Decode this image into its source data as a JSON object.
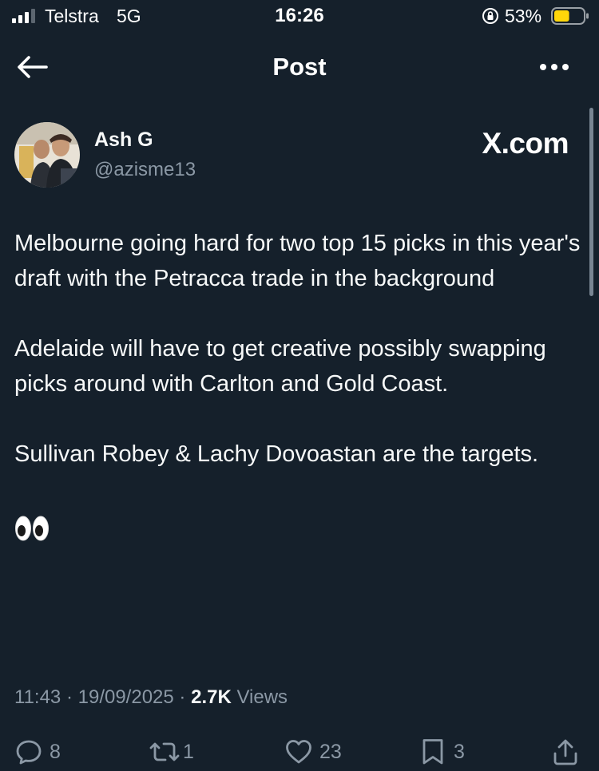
{
  "status_bar": {
    "carrier": "Telstra",
    "network": "5G",
    "time": "16:26",
    "battery_percent": "53%",
    "battery_level": 0.53,
    "battery_color": "#ffd60a"
  },
  "header": {
    "title": "Post",
    "back_icon": "arrow-left-icon",
    "more_icon": "more-horizontal-icon"
  },
  "author": {
    "name": "Ash G",
    "handle": "@azisme13",
    "watermark": "X.com"
  },
  "tweet": {
    "paragraphs": [
      "Melbourne going hard for two top 15 picks in this year's draft with the Petracca trade in the background",
      "Adelaide will have to get creative possibly swapping picks around with Carlton and Gold Coast.",
      "Sullivan Robey & Lachy Dovoastan are the targets."
    ],
    "emoji": "👀"
  },
  "meta": {
    "time": "11:43",
    "separator": "·",
    "date": "19/09/2025",
    "views_count": "2.7K",
    "views_label": "Views"
  },
  "actions": {
    "replies": "8",
    "reposts": "1",
    "likes": "23",
    "bookmarks": "3"
  },
  "colors": {
    "background": "#15202b",
    "text": "#f7f9f9",
    "secondary": "#8b98a5"
  }
}
